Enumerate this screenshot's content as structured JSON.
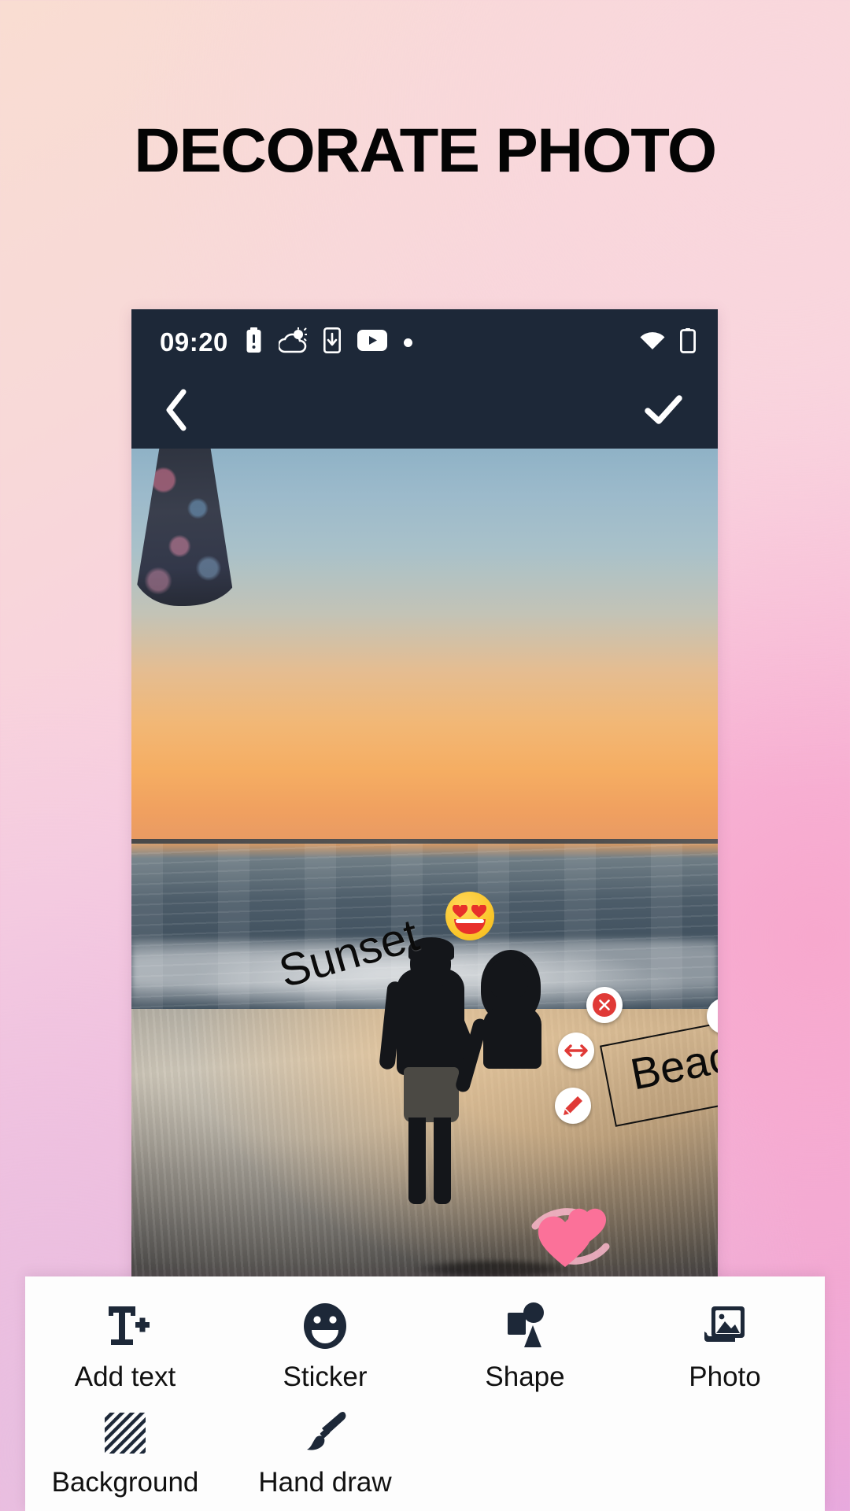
{
  "page": {
    "headline": "DECORATE PHOTO",
    "background_colors": [
      "#f9ddd2",
      "#f9cfe0",
      "#f6b9dd",
      "#e7a9dd"
    ]
  },
  "phone": {
    "status_bar": {
      "time": "09:20",
      "bg_color": "#1d2838",
      "left_icons": [
        "battery-alert-icon",
        "weather-partly-cloudy-icon",
        "download-phone-icon",
        "youtube-icon",
        "notification-dot-icon"
      ],
      "right_icons": [
        "wifi-icon",
        "battery-icon"
      ]
    },
    "app_bar": {
      "back_icon": "chevron-left-icon",
      "confirm_icon": "check-icon",
      "bg_color": "#1d2838"
    }
  },
  "canvas": {
    "stickers": [
      {
        "type": "text",
        "text": "Sunset",
        "rotation_deg": -16,
        "color": "#0b0b0b"
      },
      {
        "type": "emoji",
        "name": "smiling-face-with-heart-eyes-emoji",
        "color": "#fbc62b"
      },
      {
        "type": "sticker",
        "name": "double-heart-sticker",
        "color": "#fb7199"
      }
    ],
    "selected_object": {
      "text": "Beach",
      "rotation_deg": -11,
      "color": "#0a0a0a",
      "handles": [
        {
          "name": "delete-handle",
          "icon": "close-circle-icon",
          "color": "#e03a37"
        },
        {
          "name": "flip-vertical-handle",
          "icon": "arrow-up-down-icon",
          "color": "#e03a37"
        },
        {
          "name": "rotate-handle",
          "icon": "rotate-left-icon",
          "color": "#e03a37"
        },
        {
          "name": "flip-horizontal-handle",
          "icon": "arrow-left-right-icon",
          "color": "#e03a37"
        },
        {
          "name": "edit-handle",
          "icon": "pencil-icon",
          "color": "#e03a37"
        },
        {
          "name": "resize-handle",
          "icon": "arrow-diagonal-icon",
          "color": "#e03a37"
        }
      ]
    }
  },
  "toolbar": {
    "bg_color": "#fdfdfd",
    "icon_color": "#1d2838",
    "rows": [
      [
        {
          "label": "Add text",
          "icon": "add-text-icon"
        },
        {
          "label": "Sticker",
          "icon": "smiley-sticker-icon"
        },
        {
          "label": "Shape",
          "icon": "shape-icon"
        },
        {
          "label": "Photo",
          "icon": "photo-icon"
        }
      ],
      [
        {
          "label": "Background",
          "icon": "background-hatch-icon"
        },
        {
          "label": "Hand draw",
          "icon": "paintbrush-icon"
        }
      ]
    ]
  }
}
